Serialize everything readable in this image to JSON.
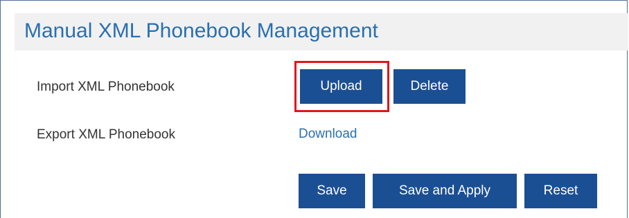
{
  "title": "Manual XML Phonebook Management",
  "import": {
    "label": "Import XML Phonebook",
    "upload_label": "Upload",
    "delete_label": "Delete"
  },
  "export": {
    "label": "Export XML Phonebook",
    "download_label": "Download"
  },
  "actions": {
    "save_label": "Save",
    "save_apply_label": "Save and Apply",
    "reset_label": "Reset"
  },
  "colors": {
    "title": "#2a6fb0",
    "button": "#1b4f93",
    "highlight": "#e3151a",
    "header_bg": "#f1f1f1"
  }
}
